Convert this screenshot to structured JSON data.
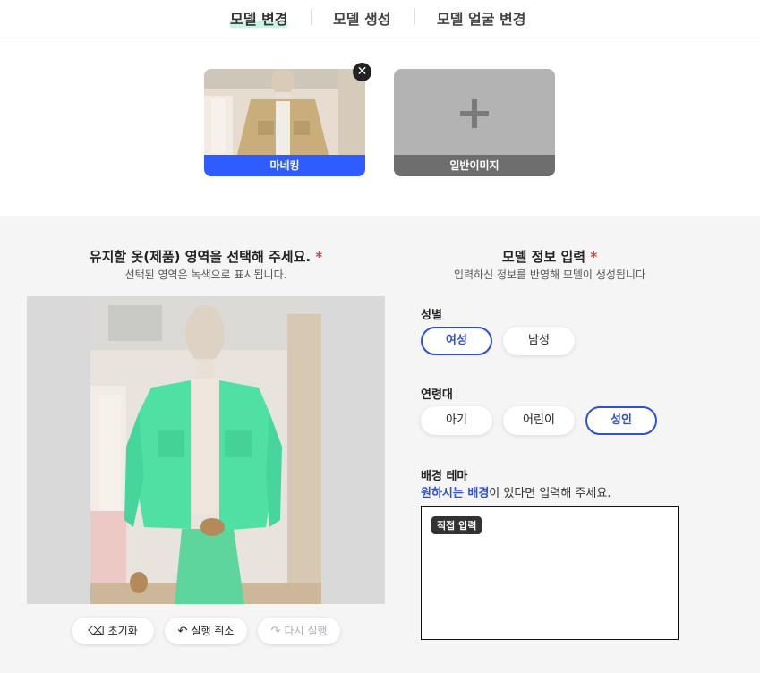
{
  "tabs": [
    {
      "label": "모델 변경",
      "active": true
    },
    {
      "label": "모델 생성",
      "active": false
    },
    {
      "label": "모델 얼굴 변경",
      "active": false
    }
  ],
  "upload": {
    "items": [
      {
        "caption": "마네킹",
        "kind": "photo"
      },
      {
        "caption": "일반이미지",
        "kind": "add"
      }
    ]
  },
  "left": {
    "title": "유지할 옷(제품) 영역을 선택해 주세요.",
    "required": "*",
    "subtitle": "선택된 영역은 녹색으로 표시됩니다.",
    "tools": [
      {
        "label": "초기화",
        "icon": "eraser-icon"
      },
      {
        "label": "실행 취소",
        "icon": "undo-icon"
      },
      {
        "label": "다시 실행",
        "icon": "redo-icon",
        "disabled": true
      }
    ]
  },
  "right": {
    "title": "모델 정보 입력",
    "required": "*",
    "subtitle": "입력하신 정보를 반영해 모델이 생성됩니다",
    "gender": {
      "label": "성별",
      "options": [
        "여성",
        "남성"
      ],
      "selected": "여성"
    },
    "age": {
      "label": "연령대",
      "options": [
        "아기",
        "어린이",
        "성인"
      ],
      "selected": "성인"
    },
    "background": {
      "label": "배경 테마",
      "hint_highlight": "원하시는 배경",
      "hint_rest": "이 있다면 입력해 주세요.",
      "badge": "직접 입력"
    }
  },
  "colors": {
    "accent": "#2e4fd6",
    "caption_blue": "#2f5cff",
    "mask_green": "#4fe0a4"
  }
}
